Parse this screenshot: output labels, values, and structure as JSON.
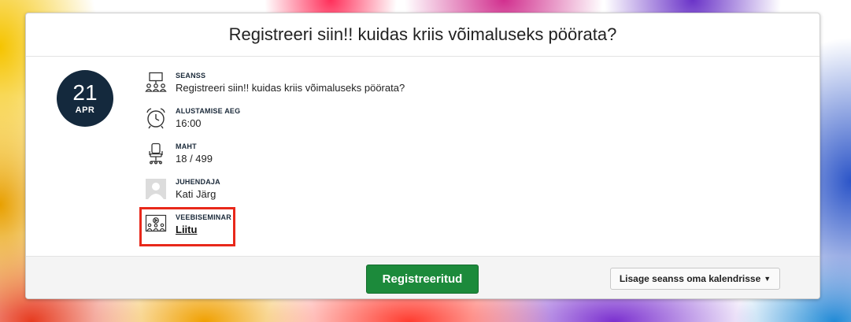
{
  "event": {
    "title": "Registreeri siin!! kuidas kriis võimaluseks pöörata?",
    "date": {
      "day": "21",
      "month": "APR"
    }
  },
  "details": {
    "session": {
      "label": "SEANSS",
      "value": "Registreeri siin!! kuidas kriis võimaluseks pöörata?",
      "icon": "presentation-icon"
    },
    "start_time": {
      "label": "ALUSTAMISE AEG",
      "value": "16:00",
      "icon": "alarm-clock-icon"
    },
    "capacity": {
      "label": "MAHT",
      "value": "18 / 499",
      "icon": "office-chair-icon"
    },
    "presenter": {
      "label": "JUHENDAJA",
      "value": "Kati Järg",
      "icon": "avatar-placeholder"
    },
    "webinar": {
      "label": "VEEBISEMINAR",
      "link": "Liitu",
      "icon": "webinar-icon",
      "highlight_color": "#e8281a"
    }
  },
  "footer": {
    "register_label": "Registreeritud",
    "calendar_label": "Lisage seanss oma kalendrisse",
    "register_color": "#1c8a3b"
  },
  "colors": {
    "date_circle": "#14293d"
  }
}
